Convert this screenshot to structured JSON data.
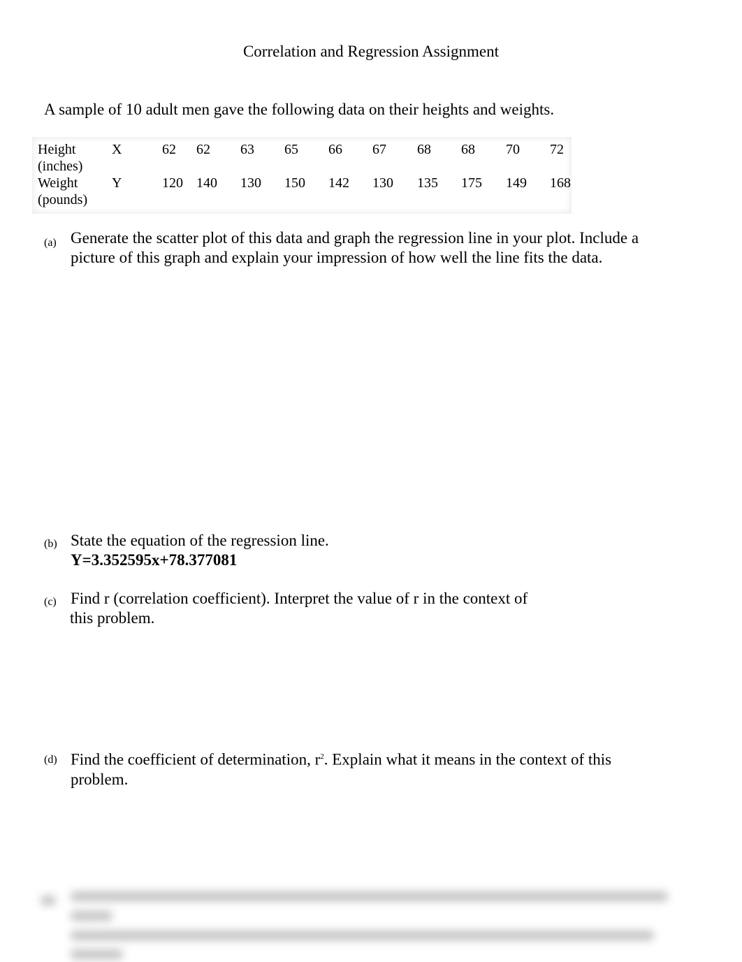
{
  "title": "Correlation and Regression Assignment",
  "intro": "A sample of 10 adult men gave the following data on their heights and weights.",
  "table": {
    "rows": [
      {
        "label1": "Height",
        "label2": "(inches)",
        "var": "X",
        "values": [
          "62",
          "62",
          "63",
          "65",
          "66",
          "67",
          "68",
          "68",
          "70",
          "72"
        ]
      },
      {
        "label1": "Weight",
        "label2": "(pounds)",
        "var": "Y",
        "values": [
          "120",
          "140",
          "130",
          "150",
          "142",
          "130",
          "135",
          "175",
          "149",
          "168"
        ]
      }
    ]
  },
  "questions": {
    "a": {
      "label": "(a)",
      "line1": "Generate the scatter plot of this data and graph the regression line in your plot. Include a",
      "line2": "picture of this graph and explain your impression of how well the line fits the data."
    },
    "b": {
      "label": "(b)",
      "line1": "State the equation of the regression line.",
      "answer": "Y=3.352595x+78.377081"
    },
    "c": {
      "label": "(c)",
      "line1": "Find r (correlation coefficient).  Interpret the value of r in the context of",
      "line2": "this problem."
    },
    "d": {
      "label": "(d)",
      "line1a": "Find the coefficient of determination, r",
      "sup": "2",
      "line1b": ".  Explain what it means in the context of this",
      "line2": "problem."
    }
  }
}
